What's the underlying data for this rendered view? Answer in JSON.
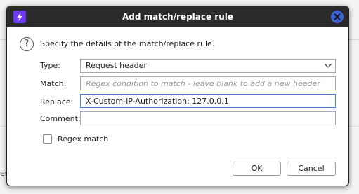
{
  "background": {
    "fragment_text": "es"
  },
  "dialog": {
    "title": "Add match/replace rule",
    "intro": "Specify the details of the match/replace rule.",
    "help_glyph": "?",
    "colors": {
      "titlebar": "#2b2b2b",
      "app_icon": "#6c3cf5",
      "close_button": "#3a64d6",
      "focus_border": "#4a7fd4"
    },
    "icons": {
      "app": "lightning-icon",
      "close": "close-icon",
      "help": "help-icon",
      "dropdown": "chevron-down-icon"
    },
    "type": {
      "label": "Type:",
      "value": "Request header"
    },
    "match": {
      "label": "Match:",
      "value": "",
      "placeholder": "Regex condition to match - leave blank to add a new header"
    },
    "replace": {
      "label": "Replace:",
      "value": "X-Custom-IP-Authorization: 127.0.0.1"
    },
    "comment": {
      "label": "Comment:",
      "value": ""
    },
    "regex_match": {
      "label": "Regex match",
      "checked": false
    },
    "buttons": {
      "ok": "OK",
      "cancel": "Cancel"
    }
  }
}
